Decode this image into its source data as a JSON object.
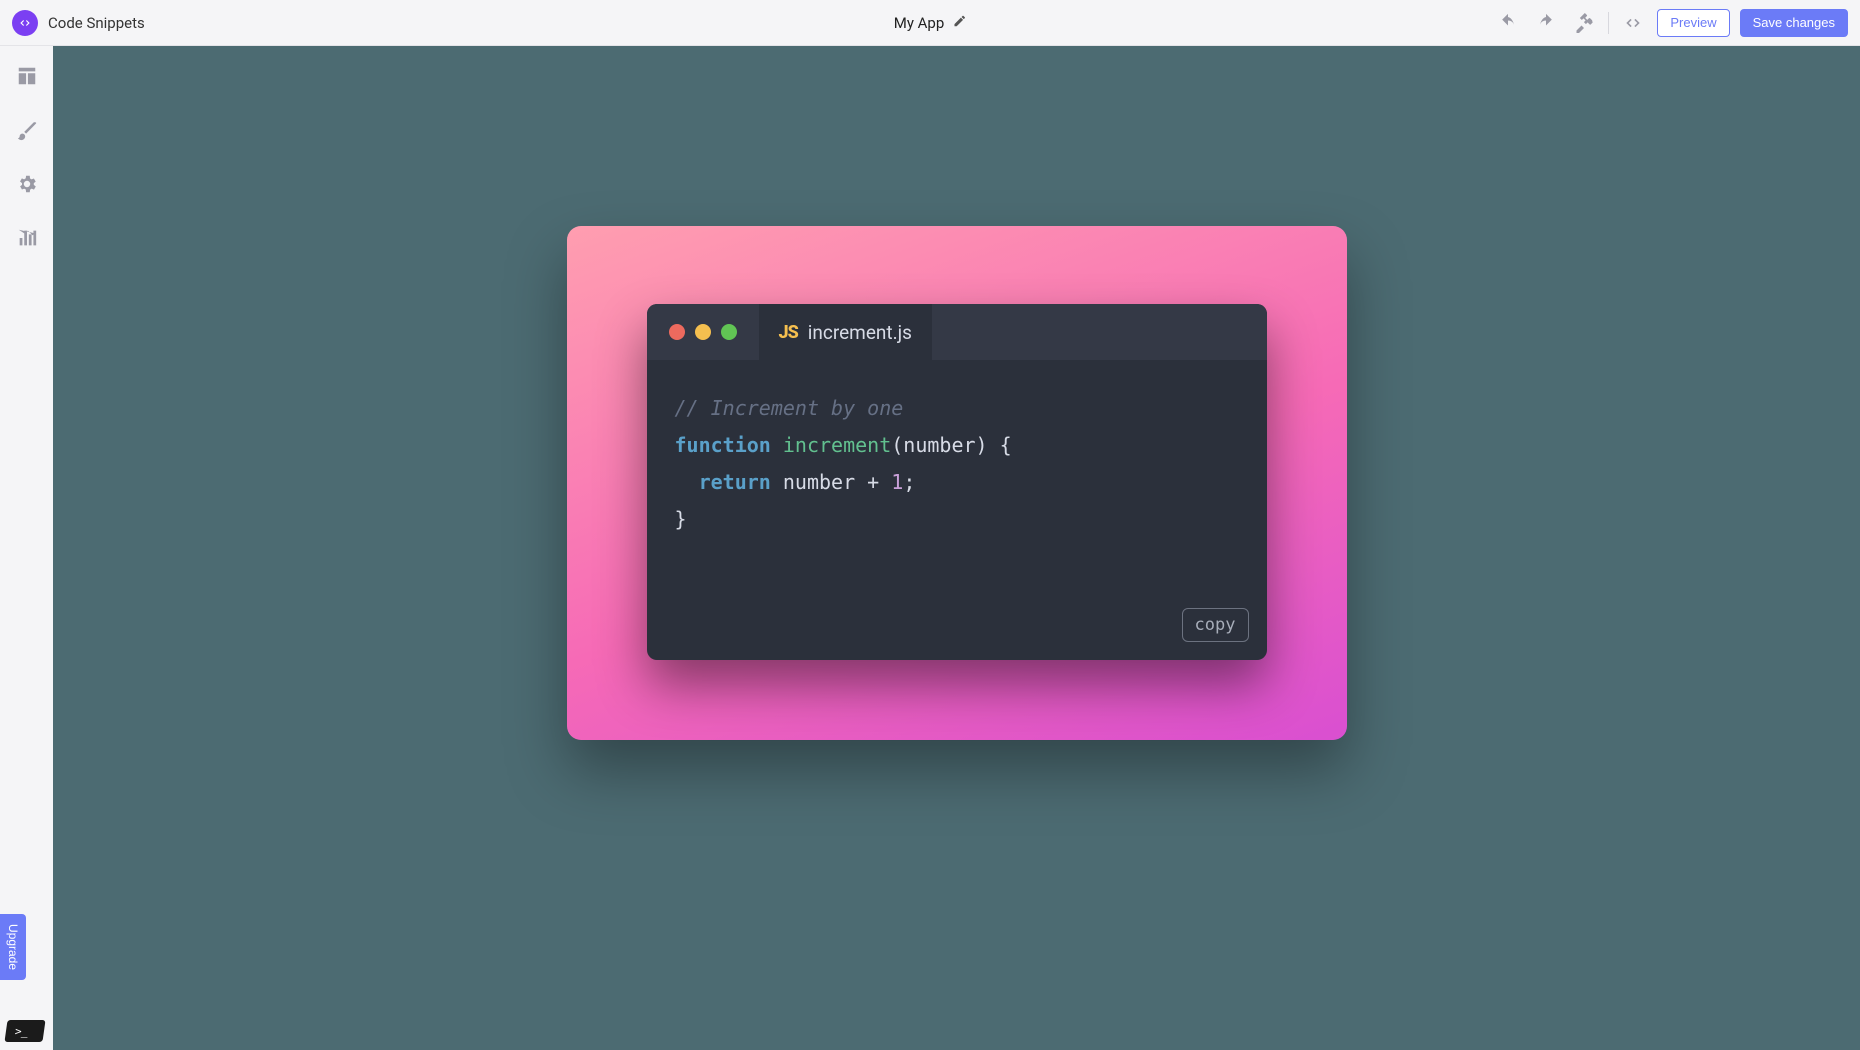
{
  "header": {
    "app_title": "Code Snippets",
    "project_name": "My App",
    "preview_label": "Preview",
    "save_label": "Save changes"
  },
  "sidebar": {
    "upgrade_label": "Upgrade"
  },
  "snippet": {
    "filename": "increment.js",
    "js_badge": "JS",
    "copy_label": "copy",
    "gradient_from": "#ff9eb0",
    "gradient_to": "#d94fd1",
    "code": {
      "comment": "// Increment by one",
      "kw_function": "function",
      "fn_name": "increment",
      "paren_open": "(",
      "param": "number",
      "paren_close_brace": ") {",
      "kw_return": "return",
      "return_expr_lhs": "number",
      "op_plus": " + ",
      "num_one": "1",
      "semicolon": ";",
      "brace_close": "}"
    }
  }
}
